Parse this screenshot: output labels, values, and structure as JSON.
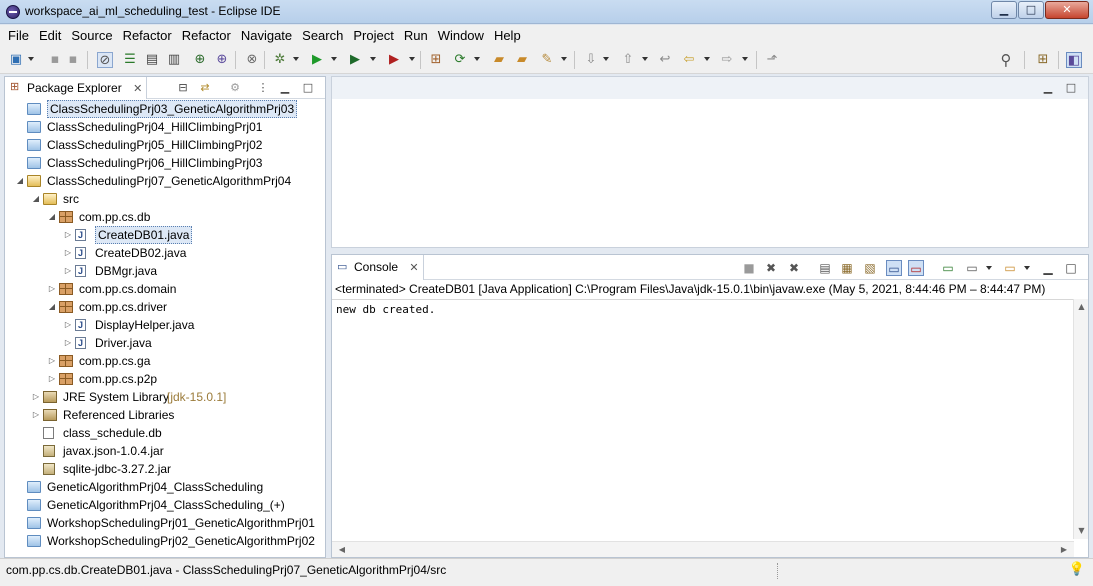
{
  "window": {
    "title": "workspace_ai_ml_scheduling_test - Eclipse IDE",
    "minimize_glyph": "▁",
    "maximize_glyph": "□",
    "close_glyph": "✕"
  },
  "menubar": {
    "items": [
      "File",
      "Edit",
      "Source",
      "Refactor",
      "Refactor",
      "Navigate",
      "Search",
      "Project",
      "Run",
      "Window",
      "Help"
    ]
  },
  "package_explorer": {
    "tab_label": "Package Explorer",
    "close_glyph": "✕",
    "tree": [
      {
        "label": "ClassSchedulingPrj03_GeneticAlgorithmPrj03",
        "icon": "project-folder-icon",
        "level": 0,
        "twisty": "",
        "selected": true
      },
      {
        "label": "ClassSchedulingPrj04_HillClimbingPrj01",
        "icon": "project-folder-icon",
        "level": 0,
        "twisty": ""
      },
      {
        "label": "ClassSchedulingPrj05_HillClimbingPrj02",
        "icon": "project-folder-icon",
        "level": 0,
        "twisty": ""
      },
      {
        "label": "ClassSchedulingPrj06_HillClimbingPrj03",
        "icon": "project-folder-icon",
        "level": 0,
        "twisty": ""
      },
      {
        "label": "ClassSchedulingPrj07_GeneticAlgorithmPrj04",
        "icon": "open-project-icon",
        "level": 0,
        "twisty": "◢"
      },
      {
        "label": "src",
        "icon": "source-folder-icon",
        "level": 1,
        "twisty": "◢"
      },
      {
        "label": "com.pp.cs.db",
        "icon": "package-icon",
        "level": 2,
        "twisty": "◢"
      },
      {
        "label": "CreateDB01.java",
        "icon": "java-file-icon",
        "level": 3,
        "twisty": "▷",
        "selected_file": true
      },
      {
        "label": "CreateDB02.java",
        "icon": "java-file-icon",
        "level": 3,
        "twisty": "▷"
      },
      {
        "label": "DBMgr.java",
        "icon": "java-file-icon",
        "level": 3,
        "twisty": "▷"
      },
      {
        "label": "com.pp.cs.domain",
        "icon": "package-icon",
        "level": 2,
        "twisty": "▷"
      },
      {
        "label": "com.pp.cs.driver",
        "icon": "package-icon",
        "level": 2,
        "twisty": "◢"
      },
      {
        "label": "DisplayHelper.java",
        "icon": "java-file-icon",
        "level": 3,
        "twisty": "▷"
      },
      {
        "label": "Driver.java",
        "icon": "java-file-icon",
        "level": 3,
        "twisty": "▷"
      },
      {
        "label": "com.pp.cs.ga",
        "icon": "package-icon",
        "level": 2,
        "twisty": "▷"
      },
      {
        "label": "com.pp.cs.p2p",
        "icon": "package-icon",
        "level": 2,
        "twisty": "▷"
      },
      {
        "label": "JRE System Library",
        "decoration": "[jdk-15.0.1]",
        "icon": "library-icon",
        "level": 1,
        "twisty": "▷"
      },
      {
        "label": "Referenced Libraries",
        "icon": "library-icon",
        "level": 1,
        "twisty": "▷"
      },
      {
        "label": "class_schedule.db",
        "icon": "file-icon",
        "level": 1,
        "twisty": ""
      },
      {
        "label": "javax.json-1.0.4.jar",
        "icon": "jar-icon",
        "level": 1,
        "twisty": ""
      },
      {
        "label": "sqlite-jdbc-3.27.2.jar",
        "icon": "jar-icon",
        "level": 1,
        "twisty": ""
      },
      {
        "label": "GeneticAlgorithmPrj04_ClassScheduling",
        "icon": "project-folder-icon",
        "level": 0,
        "twisty": ""
      },
      {
        "label": "GeneticAlgorithmPrj04_ClassScheduling_(+)",
        "icon": "project-folder-icon",
        "level": 0,
        "twisty": ""
      },
      {
        "label": "WorkshopSchedulingPrj01_GeneticAlgorithmPrj01",
        "icon": "project-folder-icon",
        "level": 0,
        "twisty": ""
      },
      {
        "label": "WorkshopSchedulingPrj02_GeneticAlgorithmPrj02",
        "icon": "project-folder-icon",
        "level": 0,
        "twisty": ""
      }
    ]
  },
  "console": {
    "tab_label": "Console",
    "close_glyph": "✕",
    "description": "<terminated> CreateDB01 [Java Application] C:\\Program Files\\Java\\jdk-15.0.1\\bin\\javaw.exe  (May 5, 2021, 8:44:46 PM – 8:44:47 PM)",
    "output": "new db created."
  },
  "statusbar": {
    "text": "com.pp.cs.db.CreateDB01.java - ClassSchedulingPrj07_GeneticAlgorithmPrj04/src"
  },
  "colors": {
    "title_bar": "#c9dcf1",
    "selection": "#dde8f6",
    "decoration": "#9b7b3a"
  }
}
